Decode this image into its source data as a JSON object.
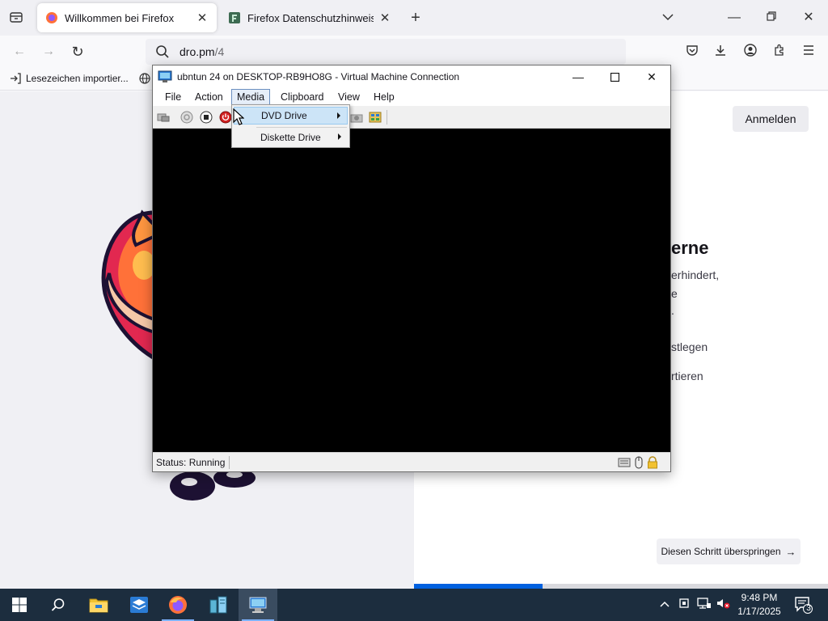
{
  "firefox": {
    "tabs": [
      {
        "title": "Willkommen bei Firefox",
        "active": true
      },
      {
        "title": "Firefox Datenschutzhinweis — M",
        "active": false
      }
    ],
    "url": {
      "host": "dro.pm",
      "path": "/4"
    },
    "bookmark_import": "Lesezeichen importier...",
    "signin": "Anmelden",
    "peek": {
      "heading": "erne",
      "line1": "erhindert,",
      "line2": "e",
      "line3": ".",
      "opt1": "stlegen",
      "opt2": "rtieren"
    },
    "skip_button": "Diesen Schritt überspringen",
    "onboarding_progress": 0.31
  },
  "vm": {
    "title": "ubntun 24 on DESKTOP-RB9HO8G - Virtual Machine Connection",
    "menu": [
      "File",
      "Action",
      "Media",
      "Clipboard",
      "View",
      "Help"
    ],
    "open_menu": "Media",
    "media_items": [
      {
        "label": "DVD Drive",
        "highlighted": true
      },
      {
        "label": "Diskette Drive",
        "highlighted": false
      }
    ],
    "status": "Status: Running"
  },
  "taskbar": {
    "time": "9:48 PM",
    "date": "1/17/2025",
    "notification_count": "3"
  },
  "colors": {
    "firefox_blue": "#0061e0",
    "taskbar_bg": "#1c2d3e",
    "vm_screen": "#000000",
    "menu_highlight": "#cce4f7"
  }
}
